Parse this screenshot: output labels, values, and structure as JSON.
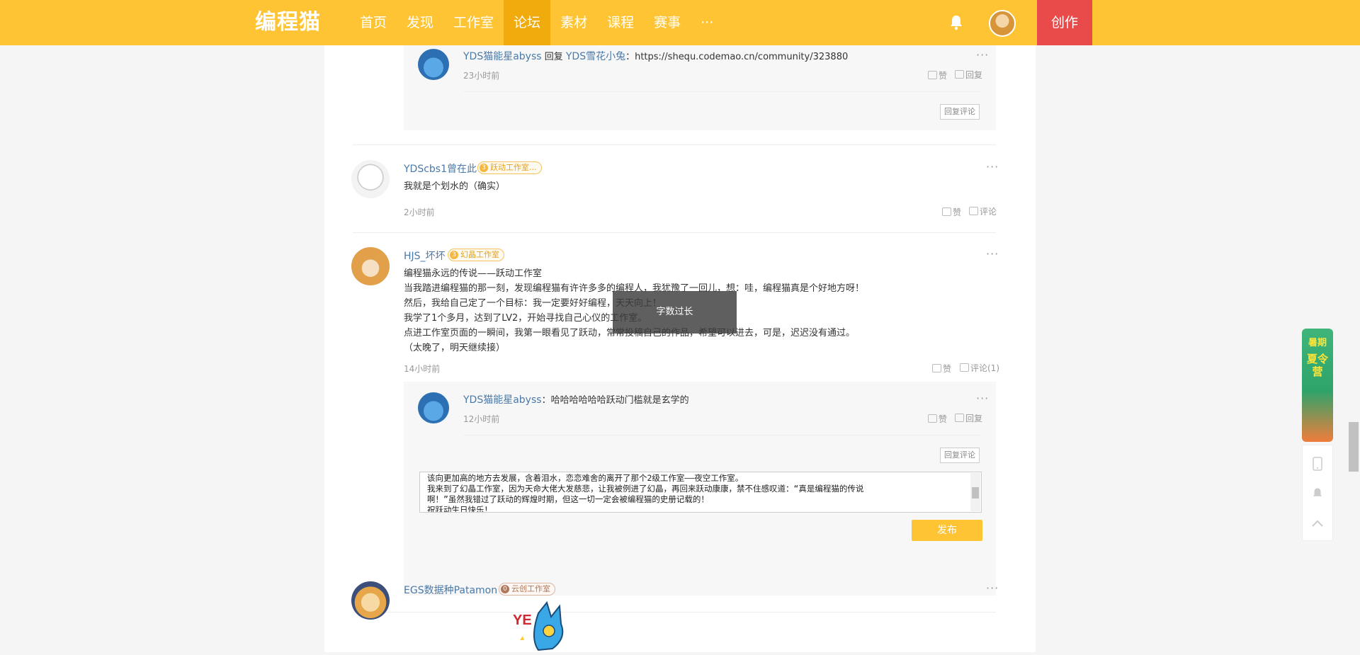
{
  "nav": {
    "logo": "编程猫",
    "items": [
      "首页",
      "发现",
      "工作室",
      "论坛",
      "素材",
      "课程",
      "赛事",
      "···"
    ],
    "create": "创作"
  },
  "reply_thread_1": {
    "user": "YDS猫能星abyss",
    "reply_word": "回复",
    "target": "YDS雪花小兔",
    "text": "：https://shequ.codemao.cn/community/323880",
    "time": "23小时前",
    "like": "赞",
    "reply": "回复",
    "reply_comment_button": "回复评论",
    "more": "···"
  },
  "comments": [
    {
      "user": "YDScbs1曾在此",
      "badge_level": "3",
      "badge": "跃动工作室...",
      "lines": [
        "我就是个划水的（确实）"
      ],
      "time": "2小时前",
      "like": "赞",
      "comment": "评论",
      "more": "···"
    },
    {
      "user": "HJS_坏坏",
      "badge_level": "3",
      "badge": "幻晶工作室",
      "lines": [
        "编程猫永远的传说——跃动工作室",
        "当我踏进编程猫的那一刻，发现编程猫有许许多多的编程人，我犹豫了一回儿，想：哇，编程猫真是个好地方呀！",
        "然后，我给自己定了一个目标：我一定要好好编程，天天向上！",
        "我学了1个多月，达到了LV2，开始寻找自己心仪的工作室。",
        "点进工作室页面的一瞬间，我第一眼看见了跃动，常常投稿自己的作品，希望可以进去，可是，迟迟没有通过。",
        "（太晚了，明天继续接）"
      ],
      "time": "14小时前",
      "like": "赞",
      "comment": "评论(1)",
      "more": "···",
      "reply": {
        "user": "YDS猫能星abyss",
        "text": "：哈哈哈哈哈哈跃动门槛就是玄学的",
        "time": "12小时前",
        "like": "赞",
        "reply": "回复",
        "more": "···"
      },
      "reply_comment_button": "回复评论",
      "textarea_lines": [
        "该向更加高的地方去发展，含着泪水，恋恋难舍的离开了那个2级工作室——夜空工作室。",
        "我来到了幻晶工作室，因为天命大佬大发慈悲，让我被例进了幻晶，再回来跃动康康，禁不住感叹道：“真是编程猫的传说",
        "啊！”虽然我错过了跃动的辉煌时期，但这一切一定会被编程猫的史册记载的！",
        "祝跃动生日快乐！"
      ],
      "publish": "发布"
    },
    {
      "user": "EGS数据种Patamon",
      "badge_level": "0",
      "badge": "云创工作室",
      "more": "···"
    }
  ],
  "toast": "字数过长",
  "promo": {
    "line1": "暑期",
    "line2": "夏令营"
  }
}
